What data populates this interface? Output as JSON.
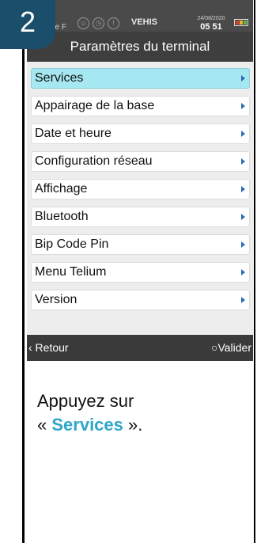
{
  "step": {
    "number": "2"
  },
  "status_bar": {
    "operator": "ge F",
    "brand": "VEHIS",
    "date": "24/08/2020",
    "time": "05 51",
    "battery_color": "#e03c2c",
    "battery_colors": [
      "#e03c2c",
      "#f0b428",
      "#5fb84a"
    ],
    "icons": [
      "person-icon",
      "clock-icon",
      "info-icon"
    ]
  },
  "header": {
    "title": "Paramètres du terminal"
  },
  "menu": {
    "items": [
      {
        "label": "Services",
        "selected": true
      },
      {
        "label": "Appairage de la base"
      },
      {
        "label": "Date et heure"
      },
      {
        "label": "Configuration réseau"
      },
      {
        "label": "Affichage"
      },
      {
        "label": "Bluetooth"
      },
      {
        "label": "Bip Code Pin"
      },
      {
        "label": "Menu Telium"
      },
      {
        "label": "Version"
      }
    ]
  },
  "footer": {
    "back_label": "‹ Retour",
    "ok_label": "○Valider"
  },
  "instruction": {
    "prefix": "Appuyez sur",
    "open_quote": "« ",
    "highlight": "Services",
    "suffix": " »."
  },
  "colors": {
    "accent": "#2fa6c8",
    "selected_bg": "#a6e8f2",
    "badge": "#1b4e6b"
  }
}
